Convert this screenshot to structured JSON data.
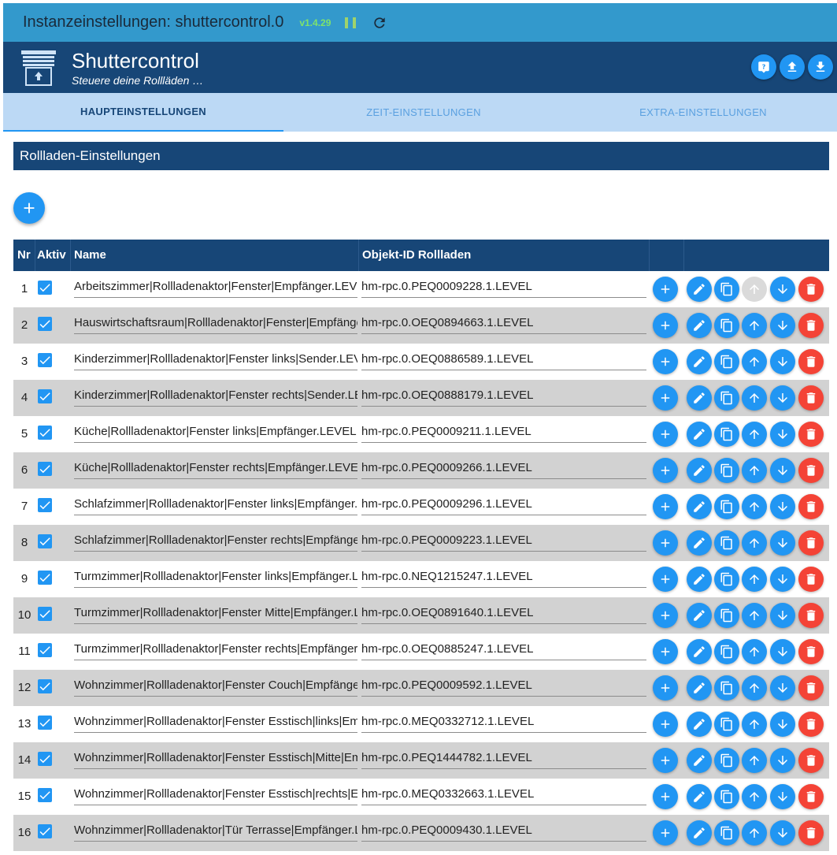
{
  "instance": {
    "title": "Instanzeinstellungen: shuttercontrol.0",
    "version": "v1.4.29"
  },
  "app": {
    "title": "Shuttercontrol",
    "subtitle": "Steuere deine Rollläden …"
  },
  "tabs": [
    {
      "label": "HAUPTEINSTELLUNGEN",
      "active": true
    },
    {
      "label": "ZEIT-EINSTELLUNGEN",
      "active": false
    },
    {
      "label": "EXTRA-EINSTELLUNGEN",
      "active": false
    }
  ],
  "section": {
    "title": "Rollladen-Einstellungen"
  },
  "table": {
    "headers": {
      "nr": "Nr",
      "active": "Aktiv",
      "name": "Name",
      "object_id": "Objekt-ID Rollladen"
    },
    "rows": [
      {
        "nr": "1",
        "active": true,
        "name": "Arbeitszimmer|Rollladenaktor|Fenster|Empfänger.LEVEL",
        "object_id": "hm-rpc.0.PEQ0009228.1.LEVEL"
      },
      {
        "nr": "2",
        "active": true,
        "name": "Hauswirtschaftsraum|Rollladenaktor|Fenster|Empfänger.LEVEL",
        "object_id": "hm-rpc.0.OEQ0894663.1.LEVEL"
      },
      {
        "nr": "3",
        "active": true,
        "name": "Kinderzimmer|Rollladenaktor|Fenster links|Sender.LEVEL",
        "object_id": "hm-rpc.0.OEQ0886589.1.LEVEL"
      },
      {
        "nr": "4",
        "active": true,
        "name": "Kinderzimmer|Rollladenaktor|Fenster rechts|Sender.LEVEL",
        "object_id": "hm-rpc.0.OEQ0888179.1.LEVEL"
      },
      {
        "nr": "5",
        "active": true,
        "name": "Küche|Rollladenaktor|Fenster links|Empfänger.LEVEL",
        "object_id": "hm-rpc.0.PEQ0009211.1.LEVEL"
      },
      {
        "nr": "6",
        "active": true,
        "name": "Küche|Rollladenaktor|Fenster rechts|Empfänger.LEVEL",
        "object_id": "hm-rpc.0.PEQ0009266.1.LEVEL"
      },
      {
        "nr": "7",
        "active": true,
        "name": "Schlafzimmer|Rollladenaktor|Fenster links|Empfänger.LEVEL",
        "object_id": "hm-rpc.0.PEQ0009296.1.LEVEL"
      },
      {
        "nr": "8",
        "active": true,
        "name": "Schlafzimmer|Rollladenaktor|Fenster rechts|Empfänger.LEVEL",
        "object_id": "hm-rpc.0.PEQ0009223.1.LEVEL"
      },
      {
        "nr": "9",
        "active": true,
        "name": "Turmzimmer|Rollladenaktor|Fenster links|Empfänger.LEVEL",
        "object_id": "hm-rpc.0.NEQ1215247.1.LEVEL"
      },
      {
        "nr": "10",
        "active": true,
        "name": "Turmzimmer|Rollladenaktor|Fenster Mitte|Empfänger.LEVEL",
        "object_id": "hm-rpc.0.OEQ0891640.1.LEVEL"
      },
      {
        "nr": "11",
        "active": true,
        "name": "Turmzimmer|Rollladenaktor|Fenster rechts|Empfänger.LEVEL",
        "object_id": "hm-rpc.0.OEQ0885247.1.LEVEL"
      },
      {
        "nr": "12",
        "active": true,
        "name": "Wohnzimmer|Rollladenaktor|Fenster Couch|Empfänger.LEVEL",
        "object_id": "hm-rpc.0.PEQ0009592.1.LEVEL"
      },
      {
        "nr": "13",
        "active": true,
        "name": "Wohnzimmer|Rollladenaktor|Fenster Esstisch|links|Empfänger.LEVEL",
        "object_id": "hm-rpc.0.MEQ0332712.1.LEVEL"
      },
      {
        "nr": "14",
        "active": true,
        "name": "Wohnzimmer|Rollladenaktor|Fenster Esstisch|Mitte|Empfänger.LEVEL",
        "object_id": "hm-rpc.0.PEQ1444782.1.LEVEL"
      },
      {
        "nr": "15",
        "active": true,
        "name": "Wohnzimmer|Rollladenaktor|Fenster Esstisch|rechts|Empfänger.LEVEL",
        "object_id": "hm-rpc.0.MEQ0332663.1.LEVEL"
      },
      {
        "nr": "16",
        "active": true,
        "name": "Wohnzimmer|Rollladenaktor|Tür Terrasse|Empfänger.LEVEL",
        "object_id": "hm-rpc.0.PEQ0009430.1.LEVEL"
      }
    ]
  },
  "row_actions": [
    "add-icon",
    "edit-icon",
    "copy-icon",
    "arrow-up-icon",
    "arrow-down-icon",
    "delete-icon"
  ],
  "header_actions": [
    "help-icon",
    "upload-icon",
    "download-icon"
  ],
  "colors": {
    "primary": "#2196f3",
    "header": "#174677",
    "topbar": "#3399cc",
    "delete": "#f44336",
    "tabs_bg": "#bcd9f5"
  }
}
